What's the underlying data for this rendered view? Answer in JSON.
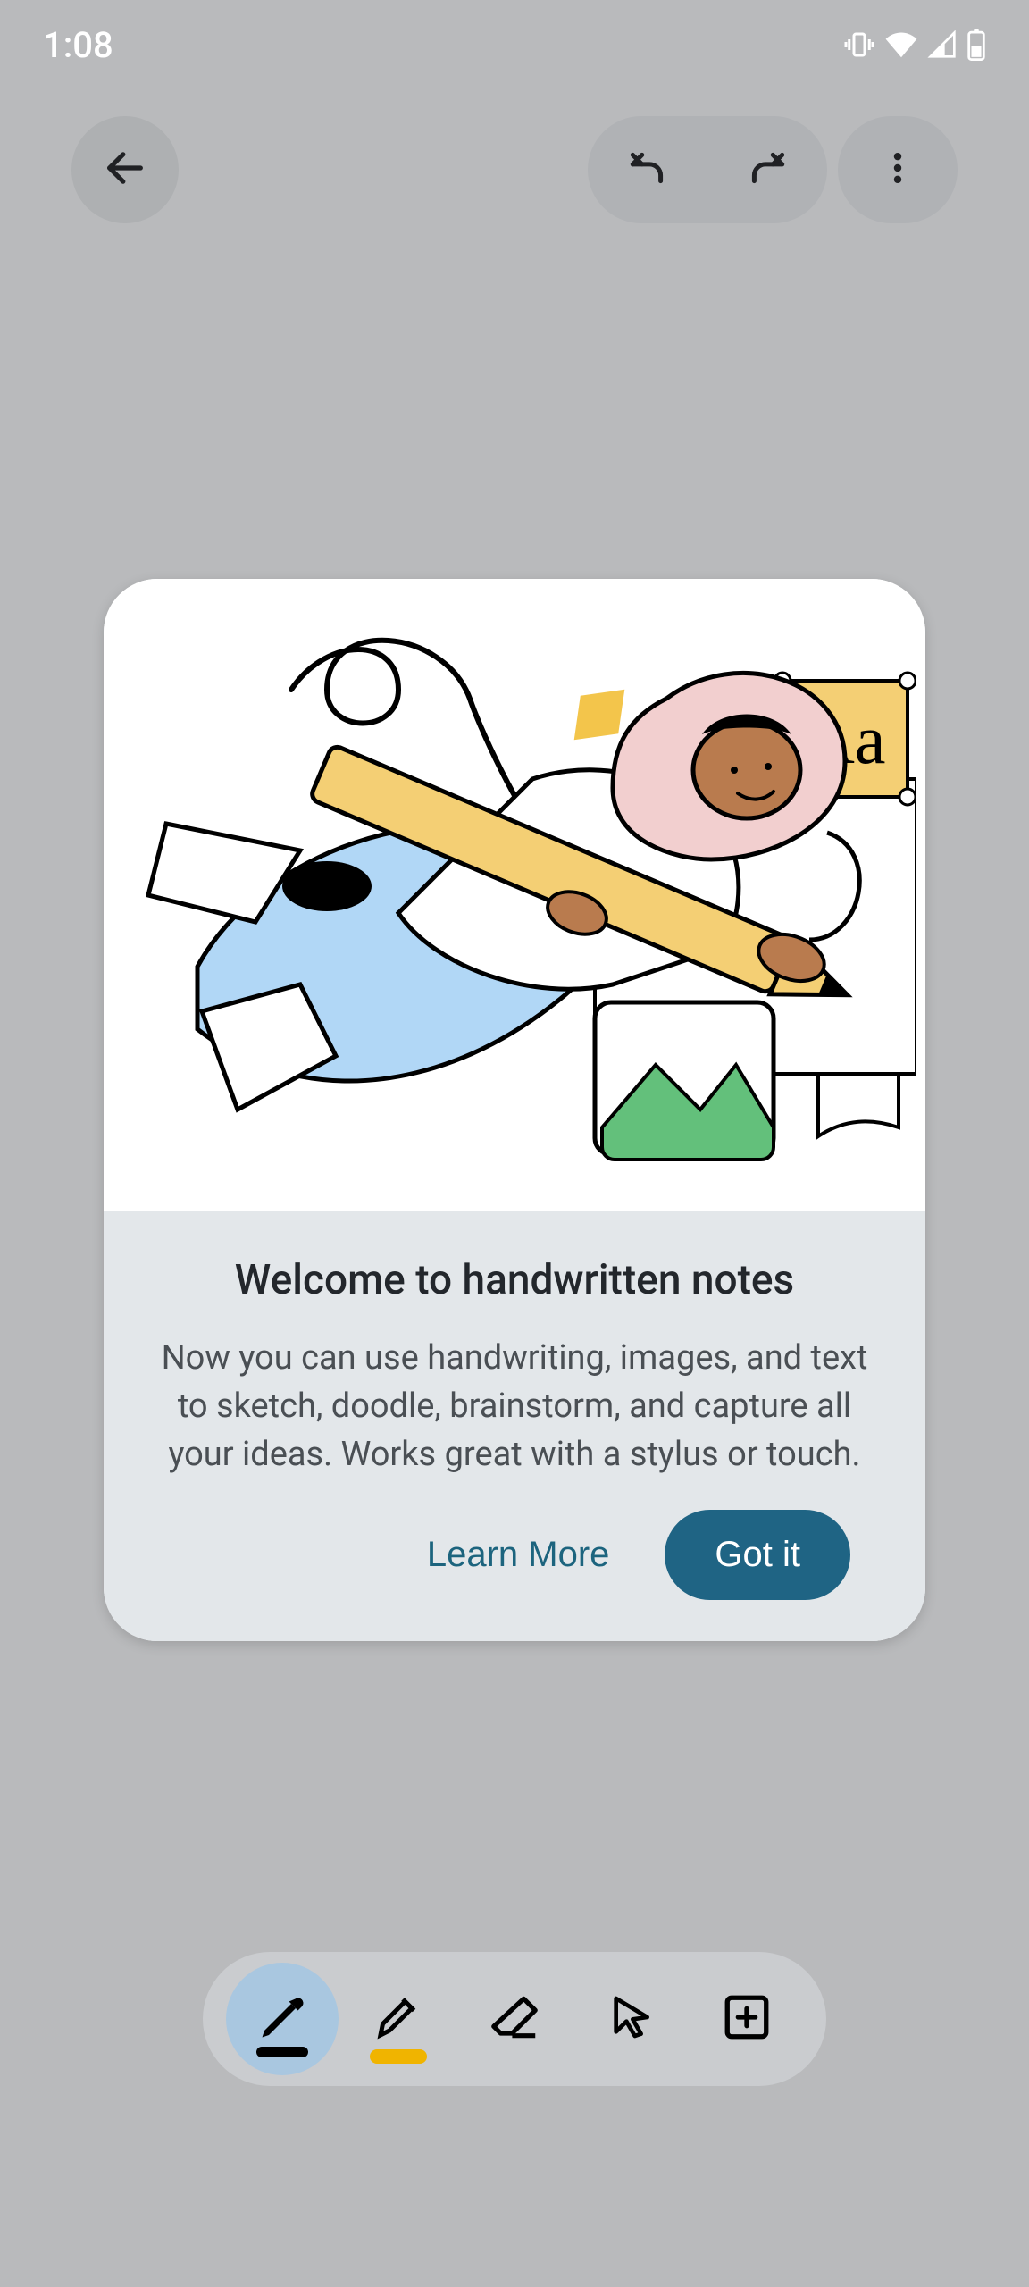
{
  "statusbar": {
    "time": "1:08"
  },
  "modal": {
    "title": "Welcome to handwritten notes",
    "body": "Now you can use handwriting, images, and text to sketch, doodle, brainstorm, and capture all your ideas. Works great with a stylus or touch.",
    "learn_more_label": "Learn More",
    "got_it_label": "Got it",
    "illustration_text_badge": "Aa"
  },
  "icons": {
    "back": "back-arrow",
    "undo": "undo",
    "redo": "redo",
    "overflow": "more-vertical",
    "vibrate": "vibrate-mode",
    "wifi": "wifi",
    "signal": "cell-signal",
    "battery": "battery-half"
  },
  "tools": {
    "pen": "pen-tool",
    "highlighter": "highlighter-tool",
    "eraser": "eraser-tool",
    "select": "select-arrow-tool",
    "insert": "insert-plus-tool"
  },
  "colors": {
    "background": "#b9babc",
    "modal_teal": "#1f6484",
    "highlighter": "#f0b400",
    "active_tool_bg": "#a9c7e0"
  }
}
